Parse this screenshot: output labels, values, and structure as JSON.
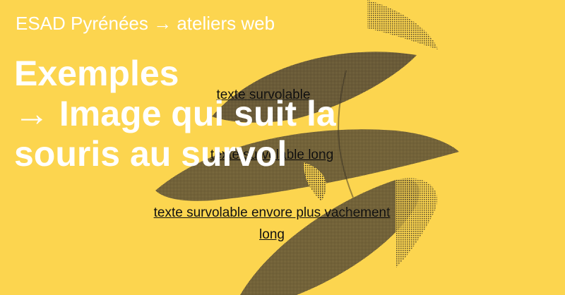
{
  "header": {
    "breadcrumb": "ESAD Pyrénées → ateliers web"
  },
  "main": {
    "title_lines": [
      "Exemples",
      "→ Image qui suit la",
      "souris au survol"
    ],
    "links": [
      "texte survolable",
      "texte survolable long",
      "texte survolable envore plus vachement long"
    ]
  },
  "theme": {
    "background": "#fcd54f",
    "heading_color": "#ffffff",
    "link_color": "#111111"
  },
  "decor": {
    "image": "dithered-bird-illustration"
  }
}
